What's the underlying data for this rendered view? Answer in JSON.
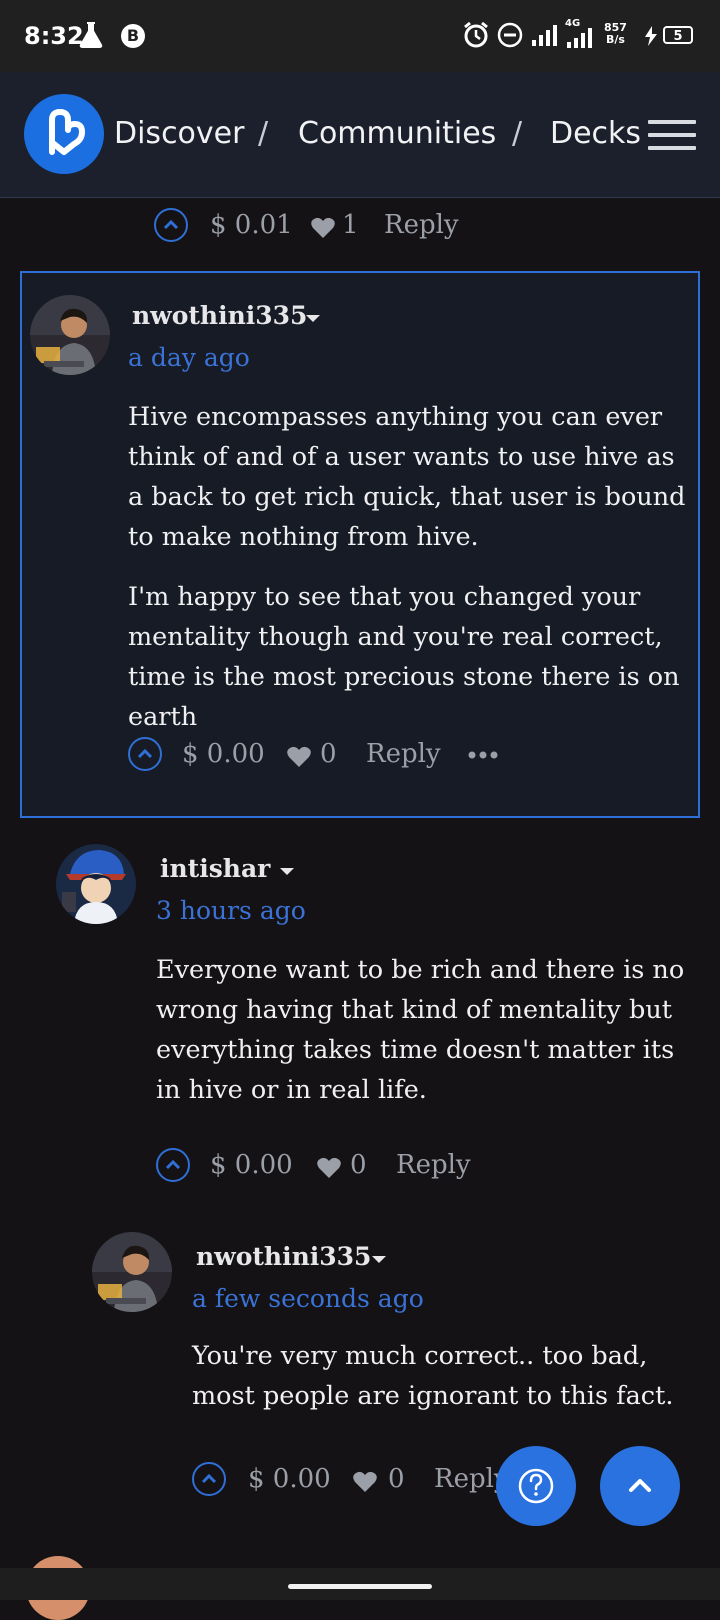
{
  "status_bar": {
    "time": "8:32",
    "network": "4G",
    "net_speed_value": "857",
    "net_speed_unit": "B/s",
    "battery": "5"
  },
  "nav": {
    "breadcrumbs": [
      "Discover",
      "Communities",
      "Decks"
    ],
    "separator": "/"
  },
  "prev_comment_meta": {
    "payout": "$ 0.01",
    "votes": "1",
    "reply": "Reply"
  },
  "comments": [
    {
      "author": "nwothini335",
      "time": "a day ago",
      "paragraphs": [
        "Hive encompasses anything you can ever think of and of a user wants to use hive as a back to get rich quick, that user is bound to make nothing from hive.",
        "I'm happy to see that you changed your mentality though and you're real correct, time is the most precious stone there is on earth"
      ],
      "payout": "$ 0.00",
      "votes": "0",
      "reply": "Reply"
    },
    {
      "author": "intishar",
      "time": "3 hours ago",
      "paragraphs": [
        "Everyone want to be rich and there is no wrong having that kind of mentality but everything takes time doesn't matter its in hive or in real life."
      ],
      "payout": "$ 0.00",
      "votes": "0",
      "reply": "Reply"
    },
    {
      "author": "nwothini335",
      "time": "a few seconds ago",
      "paragraphs": [
        "You're very much correct.. too bad, most people are ignorant to this fact."
      ],
      "payout": "$ 0.00",
      "votes": "0",
      "reply": "Reply"
    }
  ],
  "colors": {
    "accent": "#2a72e0",
    "link_time": "#3a72d6",
    "background": "#141214",
    "highlight_box": "#171b25"
  }
}
